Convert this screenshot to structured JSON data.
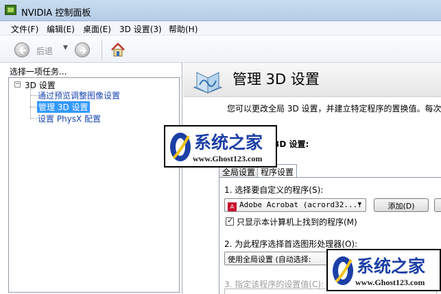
{
  "window": {
    "title": "NVIDIA 控制面板"
  },
  "menu": [
    {
      "label": "文件(F)"
    },
    {
      "label": "编辑(E)"
    },
    {
      "label": "桌面(E)"
    },
    {
      "label": "3D 设置(3)"
    },
    {
      "label": "帮助(H)"
    }
  ],
  "toolbar": {
    "back_icon": "back-arrow-icon",
    "back_label": "后退",
    "forward_icon": "forward-arrow-icon",
    "home_icon": "home-icon"
  },
  "sidebar": {
    "header": "选择一项任务...",
    "tree": {
      "root": "3D 设置",
      "children": [
        {
          "label": "通过预览调整图像设置"
        },
        {
          "label": "管理 3D 设置",
          "selected": true
        },
        {
          "label": "设置 PhysX 配置"
        }
      ]
    }
  },
  "main": {
    "title": "管理 3D 设置",
    "description": "您可以更改全局 3D 设置，并建立特定程序的置换值。每次",
    "section_title": "3D 设置:",
    "tabs": [
      {
        "label": "全局设置",
        "active": false
      },
      {
        "label": "程序设置",
        "active": true
      }
    ],
    "step1": {
      "label": "1. 选择要自定义的程序(S):",
      "selected_program": "Adobe Acrobat (acrord32....",
      "program_icon": "pdf-icon",
      "add_button": "添加(D)",
      "checkbox_label": "只显示本计算机上找到的程序(M)",
      "checkbox_checked": true
    },
    "step2": {
      "label": "2. 为此程序选择首选图形处理器(O):",
      "selected": "使用全局设置 (自动选择:"
    },
    "step3": {
      "label": "3. 指定该程序的设置值(C):"
    }
  },
  "watermark": {
    "title": "系统之家",
    "url": "www.Ghost123.com"
  },
  "colors": {
    "selection": "#3399ff",
    "link": "#1a45b0",
    "watermark_blue": "#1c3fa6"
  }
}
